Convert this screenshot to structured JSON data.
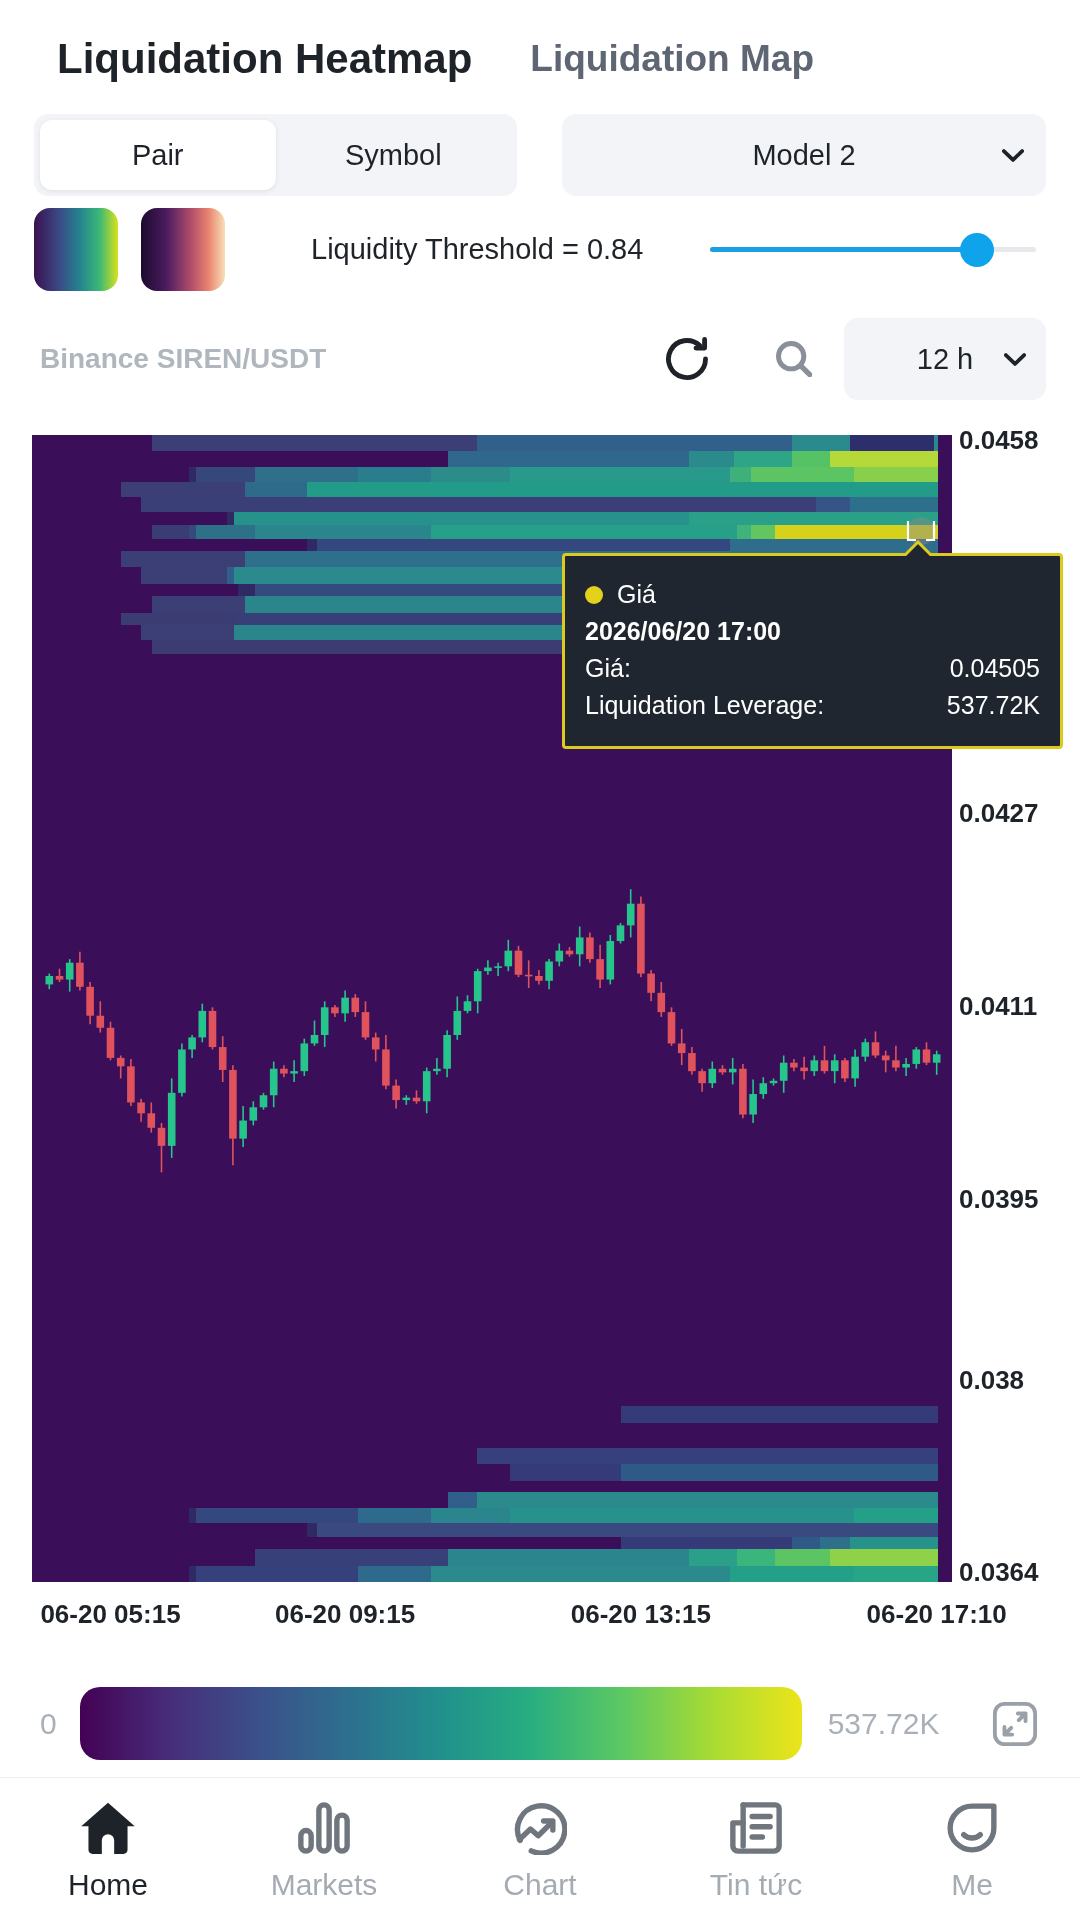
{
  "header_tabs": [
    {
      "label": "Liquidation Heatmap",
      "selected": true
    },
    {
      "label": "Liquidation Map",
      "selected": false
    }
  ],
  "mode_toggle": [
    {
      "label": "Pair",
      "selected": true
    },
    {
      "label": "Symbol",
      "selected": false
    }
  ],
  "model_select": {
    "value": "Model 2"
  },
  "palettes": [
    {
      "kind": "viridis"
    },
    {
      "kind": "magma"
    }
  ],
  "threshold": {
    "label": "Liquidity Threshold = 0.84",
    "level": 0.82
  },
  "market": {
    "label": "Binance SIREN/USDT"
  },
  "interval_select": {
    "value": "12 h"
  },
  "chart": {
    "chart_data": {
      "type": "candlestick",
      "categories": [
        null,
        null,
        null,
        null,
        null,
        null,
        "06-20 05:15",
        null,
        null,
        null,
        null,
        null,
        null,
        null,
        null,
        null,
        null,
        null,
        null,
        null,
        null,
        null,
        null,
        null,
        null,
        null,
        null,
        null,
        null,
        "06-20 09:15",
        null,
        null,
        null,
        null,
        null,
        null,
        null,
        null,
        null,
        null,
        null,
        null,
        null,
        null,
        null,
        null,
        null,
        null,
        null,
        null,
        null,
        null,
        null,
        null,
        null,
        null,
        null,
        null,
        "06-20 13:15",
        null,
        null,
        null,
        null,
        null,
        null,
        null,
        null,
        null,
        null,
        null,
        null,
        null,
        null,
        null,
        null,
        null,
        null,
        null,
        null,
        null,
        null,
        null,
        null,
        null,
        null,
        null,
        null,
        "06-20 17:10"
      ],
      "ohlc": [
        [
          0.04128,
          0.04137,
          0.04124,
          0.04135
        ],
        [
          0.04135,
          0.04141,
          0.0413,
          0.04132
        ],
        [
          0.04132,
          0.04149,
          0.04122,
          0.04146
        ],
        [
          0.04146,
          0.04155,
          0.04123,
          0.04126
        ],
        [
          0.04126,
          0.0413,
          0.04095,
          0.04102
        ],
        [
          0.04102,
          0.04114,
          0.04088,
          0.04092
        ],
        [
          0.04092,
          0.04097,
          0.04065,
          0.04067
        ],
        [
          0.04067,
          0.04069,
          0.0405,
          0.0406
        ],
        [
          0.0406,
          0.04066,
          0.04027,
          0.0403
        ],
        [
          0.0403,
          0.04033,
          0.04014,
          0.04021
        ],
        [
          0.04021,
          0.0403,
          0.04005,
          0.04009
        ],
        [
          0.04009,
          0.04013,
          0.03972,
          0.03994
        ],
        [
          0.03994,
          0.0405,
          0.03984,
          0.04038
        ],
        [
          0.04038,
          0.04079,
          0.04035,
          0.04074
        ],
        [
          0.04074,
          0.04086,
          0.04067,
          0.04084
        ],
        [
          0.04084,
          0.04112,
          0.0408,
          0.04106
        ],
        [
          0.04106,
          0.04109,
          0.04074,
          0.04076
        ],
        [
          0.04076,
          0.04085,
          0.04047,
          0.04057
        ],
        [
          0.04057,
          0.04061,
          0.03978,
          0.04
        ],
        [
          0.04,
          0.04027,
          0.03993,
          0.04015
        ],
        [
          0.04015,
          0.04031,
          0.04011,
          0.04026
        ],
        [
          0.04026,
          0.04038,
          0.04024,
          0.04036
        ],
        [
          0.04036,
          0.04064,
          0.04026,
          0.04058
        ],
        [
          0.04058,
          0.04061,
          0.04051,
          0.04054
        ],
        [
          0.04054,
          0.04065,
          0.04047,
          0.04056
        ],
        [
          0.04056,
          0.04083,
          0.04052,
          0.04079
        ],
        [
          0.04079,
          0.04098,
          0.04077,
          0.04086
        ],
        [
          0.04086,
          0.04114,
          0.04076,
          0.04109
        ],
        [
          0.04109,
          0.04111,
          0.04101,
          0.04104
        ],
        [
          0.04104,
          0.04123,
          0.04097,
          0.04117
        ],
        [
          0.04117,
          0.0412,
          0.04101,
          0.04105
        ],
        [
          0.04105,
          0.04114,
          0.04082,
          0.04084
        ],
        [
          0.04084,
          0.04088,
          0.04064,
          0.04074
        ],
        [
          0.04074,
          0.04086,
          0.04041,
          0.04044
        ],
        [
          0.04044,
          0.04049,
          0.04025,
          0.04032
        ],
        [
          0.04032,
          0.04036,
          0.04028,
          0.04034
        ],
        [
          0.04034,
          0.0404,
          0.04029,
          0.04031
        ],
        [
          0.04031,
          0.04059,
          0.04021,
          0.04056
        ],
        [
          0.04056,
          0.04067,
          0.04053,
          0.04058
        ],
        [
          0.04058,
          0.0409,
          0.04051,
          0.04086
        ],
        [
          0.04086,
          0.04118,
          0.04082,
          0.04106
        ],
        [
          0.04106,
          0.04119,
          0.04104,
          0.04114
        ],
        [
          0.04114,
          0.04141,
          0.04104,
          0.04139
        ],
        [
          0.04139,
          0.04148,
          0.04136,
          0.04142
        ],
        [
          0.04142,
          0.04146,
          0.04135,
          0.04143
        ],
        [
          0.04143,
          0.04165,
          0.04139,
          0.04156
        ],
        [
          0.04156,
          0.0416,
          0.04134,
          0.04136
        ],
        [
          0.04136,
          0.04148,
          0.04125,
          0.04135
        ],
        [
          0.04135,
          0.0414,
          0.04128,
          0.04131
        ],
        [
          0.04131,
          0.04149,
          0.04124,
          0.04147
        ],
        [
          0.04147,
          0.04162,
          0.04143,
          0.04156
        ],
        [
          0.04156,
          0.04159,
          0.04151,
          0.04153
        ],
        [
          0.04153,
          0.04176,
          0.04143,
          0.04167
        ],
        [
          0.04167,
          0.04171,
          0.04146,
          0.04149
        ],
        [
          0.04149,
          0.04161,
          0.04125,
          0.04132
        ],
        [
          0.04132,
          0.04169,
          0.04128,
          0.04164
        ],
        [
          0.04164,
          0.04179,
          0.04162,
          0.04177
        ],
        [
          0.04177,
          0.04207,
          0.04167,
          0.04195
        ],
        [
          0.04195,
          0.04201,
          0.04134,
          0.04137
        ],
        [
          0.04137,
          0.0414,
          0.04114,
          0.04121
        ],
        [
          0.04121,
          0.0413,
          0.04101,
          0.04105
        ],
        [
          0.04105,
          0.04109,
          0.04077,
          0.04079
        ],
        [
          0.04079,
          0.04091,
          0.04061,
          0.04071
        ],
        [
          0.04071,
          0.04076,
          0.04053,
          0.04056
        ],
        [
          0.04056,
          0.04058,
          0.04039,
          0.04046
        ],
        [
          0.04046,
          0.04064,
          0.04042,
          0.04058
        ],
        [
          0.04058,
          0.04061,
          0.04053,
          0.04055
        ],
        [
          0.04055,
          0.04067,
          0.04045,
          0.04058
        ],
        [
          0.04058,
          0.04062,
          0.04017,
          0.0402
        ],
        [
          0.0402,
          0.04049,
          0.04013,
          0.04037
        ],
        [
          0.04037,
          0.04051,
          0.04033,
          0.04046
        ],
        [
          0.04046,
          0.0405,
          0.04044,
          0.04048
        ],
        [
          0.04048,
          0.04069,
          0.04038,
          0.04063
        ],
        [
          0.04063,
          0.04066,
          0.04056,
          0.04059
        ],
        [
          0.04059,
          0.04068,
          0.04049,
          0.04056
        ],
        [
          0.04056,
          0.04069,
          0.04052,
          0.04065
        ],
        [
          0.04065,
          0.04077,
          0.04054,
          0.04056
        ],
        [
          0.04056,
          0.0407,
          0.04046,
          0.04065
        ],
        [
          0.04065,
          0.04067,
          0.04047,
          0.0405
        ],
        [
          0.0405,
          0.04074,
          0.04043,
          0.04068
        ],
        [
          0.04068,
          0.04083,
          0.04064,
          0.0408
        ],
        [
          0.0408,
          0.04089,
          0.04067,
          0.04069
        ],
        [
          0.04069,
          0.04073,
          0.04055,
          0.04065
        ],
        [
          0.04065,
          0.04077,
          0.04056,
          0.04059
        ],
        [
          0.04059,
          0.04067,
          0.04052,
          0.04062
        ],
        [
          0.04062,
          0.04076,
          0.04058,
          0.04074
        ],
        [
          0.04074,
          0.0408,
          0.04061,
          0.04063
        ],
        [
          0.04063,
          0.04073,
          0.04053,
          0.0407
        ]
      ],
      "ylim": [
        0.03632,
        0.04584
      ],
      "yticks": [
        {
          "value": 0.0458,
          "label": "0.0458"
        },
        {
          "value": 0.0427,
          "label": "0.0427"
        },
        {
          "value": 0.0411,
          "label": "0.0411"
        },
        {
          "value": 0.0395,
          "label": "0.0395"
        },
        {
          "value": 0.038,
          "label": "0.038"
        },
        {
          "value": 0.0364,
          "label": "0.0364"
        }
      ]
    },
    "tooltip": {
      "series": "Giá",
      "time": "2026/06/20 17:00",
      "rows": [
        {
          "label": "Giá:",
          "value": "0.04505"
        },
        {
          "label": "Liquidation Leverage:",
          "value": "537.72K"
        }
      ]
    }
  },
  "color_scale": {
    "min": "0",
    "max": "537.72K"
  },
  "bottom_nav": [
    {
      "label": "Home",
      "kind": "home",
      "selected": true
    },
    {
      "label": "Markets",
      "kind": "markets",
      "selected": false
    },
    {
      "label": "Chart",
      "kind": "chart",
      "selected": false
    },
    {
      "label": "Tin tức",
      "kind": "news",
      "selected": false
    },
    {
      "label": "Me",
      "kind": "profile",
      "selected": false
    }
  ]
}
